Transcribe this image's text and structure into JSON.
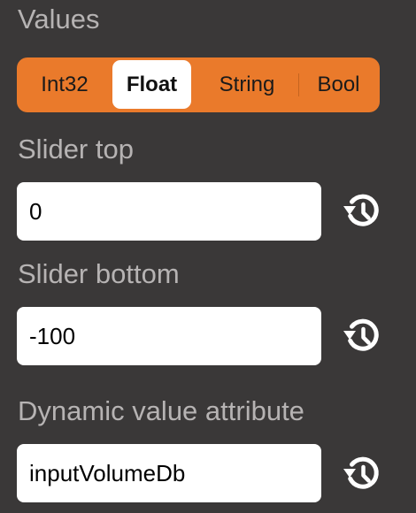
{
  "sections": {
    "values_label": "Values",
    "slider_top_label": "Slider top",
    "slider_bottom_label": "Slider bottom",
    "dynamic_attr_label": "Dynamic value attribute"
  },
  "value_type": {
    "options": [
      "Int32",
      "Float",
      "String",
      "Bool"
    ],
    "selected": "Float"
  },
  "fields": {
    "slider_top": "0",
    "slider_bottom": "-100",
    "dynamic_attr": "inputVolumeDb"
  },
  "icons": {
    "reset": "history-icon"
  },
  "colors": {
    "background": "#3a3838",
    "accent": "#ea7a2b",
    "label": "#b6b3b3",
    "field_bg": "#ffffff"
  }
}
